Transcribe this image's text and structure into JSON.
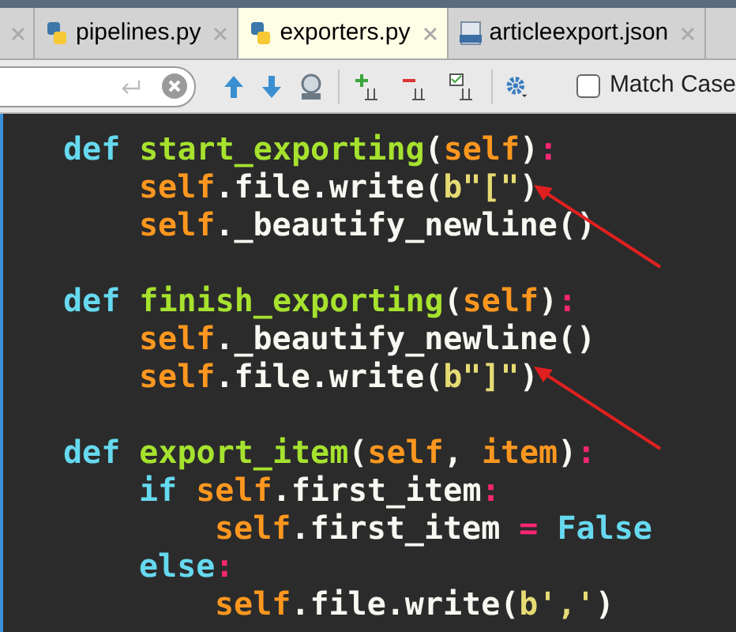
{
  "tabs": [
    {
      "selected": false,
      "kind": "partial"
    },
    {
      "label": "pipelines.py",
      "selected": false,
      "kind": "python"
    },
    {
      "label": "exporters.py",
      "selected": true,
      "kind": "python"
    },
    {
      "label": "articleexport.json",
      "selected": false,
      "kind": "json"
    }
  ],
  "find_bar": {
    "match_case": {
      "label": "Match Case",
      "checked": false
    }
  },
  "code": [
    {
      "tokens": [
        {
          "t": "def ",
          "kind": "keyword"
        },
        {
          "t": "start_exporting",
          "kind": "function"
        },
        {
          "t": "(",
          "kind": "plain"
        },
        {
          "t": "self",
          "kind": "self"
        },
        {
          "t": ")",
          "kind": "plain"
        },
        {
          "t": ":",
          "kind": "operator"
        }
      ],
      "children": [
        {
          "tokens": [
            {
              "t": "self",
              "kind": "self"
            },
            {
              "t": ".file.write(",
              "kind": "plain"
            },
            {
              "t": "b\"[\"",
              "kind": "string"
            },
            {
              "t": ")",
              "kind": "plain"
            }
          ]
        },
        {
          "tokens": [
            {
              "t": "self",
              "kind": "self"
            },
            {
              "t": "._beautify_newline()",
              "kind": "plain"
            }
          ]
        }
      ]
    },
    {
      "tokens": [
        {
          "t": "def ",
          "kind": "keyword"
        },
        {
          "t": "finish_exporting",
          "kind": "function"
        },
        {
          "t": "(",
          "kind": "plain"
        },
        {
          "t": "self",
          "kind": "self"
        },
        {
          "t": ")",
          "kind": "plain"
        },
        {
          "t": ":",
          "kind": "operator"
        }
      ],
      "children": [
        {
          "tokens": [
            {
              "t": "self",
              "kind": "self"
            },
            {
              "t": "._beautify_newline()",
              "kind": "plain"
            }
          ]
        },
        {
          "tokens": [
            {
              "t": "self",
              "kind": "self"
            },
            {
              "t": ".file.write(",
              "kind": "plain"
            },
            {
              "t": "b\"]\"",
              "kind": "string"
            },
            {
              "t": ")",
              "kind": "plain"
            }
          ]
        }
      ]
    },
    {
      "tokens": [
        {
          "t": "def ",
          "kind": "keyword"
        },
        {
          "t": "export_item",
          "kind": "function"
        },
        {
          "t": "(",
          "kind": "plain"
        },
        {
          "t": "self",
          "kind": "self"
        },
        {
          "t": ", ",
          "kind": "plain"
        },
        {
          "t": "item",
          "kind": "self"
        },
        {
          "t": ")",
          "kind": "plain"
        },
        {
          "t": ":",
          "kind": "operator"
        }
      ],
      "children": [
        {
          "tokens": [
            {
              "t": "if ",
              "kind": "keyword"
            },
            {
              "t": "self",
              "kind": "self"
            },
            {
              "t": ".first_item",
              "kind": "plain"
            },
            {
              "t": ":",
              "kind": "operator"
            }
          ],
          "children": [
            {
              "tokens": [
                {
                  "t": "self",
                  "kind": "self"
                },
                {
                  "t": ".first_item ",
                  "kind": "plain"
                },
                {
                  "t": "=",
                  "kind": "operator"
                },
                {
                  "t": " False",
                  "kind": "keyword"
                }
              ]
            }
          ]
        },
        {
          "tokens": [
            {
              "t": "else",
              "kind": "keyword"
            },
            {
              "t": ":",
              "kind": "operator"
            }
          ],
          "children": [
            {
              "tokens": [
                {
                  "t": "self",
                  "kind": "self"
                },
                {
                  "t": ".file.write(",
                  "kind": "plain"
                },
                {
                  "t": "b','",
                  "kind": "string"
                },
                {
                  "t": ")",
                  "kind": "plain"
                }
              ]
            }
          ]
        }
      ]
    }
  ]
}
